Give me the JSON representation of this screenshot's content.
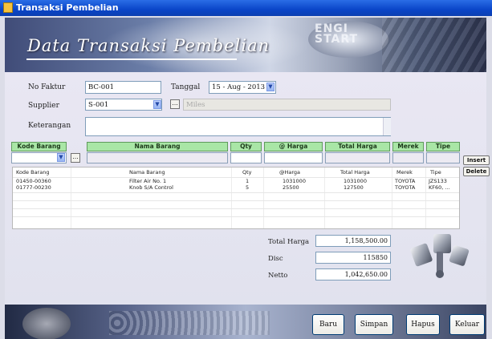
{
  "window": {
    "title": "Transaksi Pembelian"
  },
  "banner": {
    "heading": "Data Transaksi Pembelian",
    "badge_line1": "ENGI",
    "badge_line2": "START"
  },
  "form": {
    "no_faktur_label": "No Faktur",
    "no_faktur_value": "BC-001",
    "tanggal_label": "Tanggal",
    "tanggal_value": "15 - Aug - 2013",
    "supplier_label": "Supplier",
    "supplier_value": "S-001",
    "supplier_name_value": "Miles",
    "keterangan_label": "Keterangan",
    "keterangan_value": ""
  },
  "entry_grid": {
    "headers": [
      "Kode Barang",
      "Nama Barang",
      "Qty",
      "@ Harga",
      "Total Harga",
      "Merek",
      "Tipe"
    ],
    "insert_label": "Insert",
    "delete_label": "Delete",
    "lookup_label": "..."
  },
  "items_grid": {
    "headers": [
      "Kode Barang",
      "Nama Barang",
      "Qty",
      "@Harga",
      "Total Harga",
      "Merek",
      "Tipe"
    ],
    "rows": [
      [
        "01450-00360",
        "Filter Air No. 1",
        "1",
        "1031000",
        "1031000",
        "TOYOTA",
        "JZS133"
      ],
      [
        "01777-00230",
        "Knob S/A Control",
        "5",
        "25500",
        "127500",
        "TOYOTA",
        "KF60, ..."
      ]
    ]
  },
  "totals": {
    "total_harga_label": "Total Harga",
    "total_harga_value": "1,158,500.00",
    "disc_label": "Disc",
    "disc_value": "115850",
    "netto_label": "Netto",
    "netto_value": "1,042,650.00"
  },
  "buttons": {
    "baru": "Baru",
    "simpan": "Simpan",
    "hapus": "Hapus",
    "keluar": "Keluar"
  },
  "colors": {
    "titlebar": "#0a45c8",
    "grid_header": "#a9e6a6",
    "field_border": "#7f9db9"
  }
}
